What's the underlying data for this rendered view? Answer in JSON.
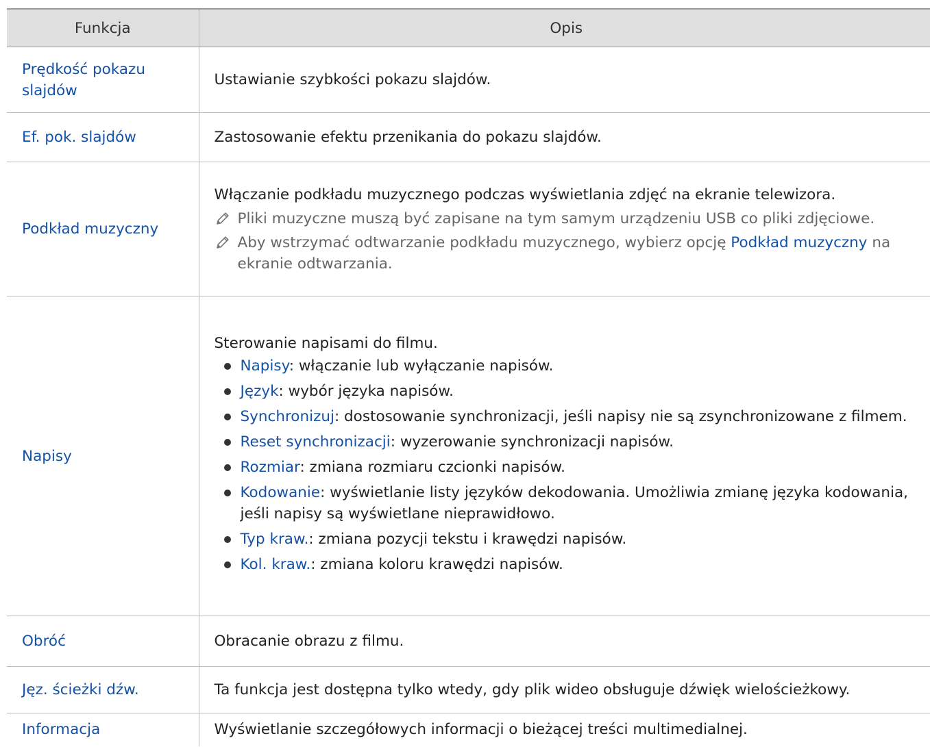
{
  "table": {
    "header": {
      "col1": "Funkcja",
      "col2": "Opis"
    },
    "rows": [
      {
        "name": "Prędkość pokazu slajdów",
        "desc": "Ustawianie szybkości pokazu slajdów."
      },
      {
        "name": "Ef. pok. slajdów",
        "desc": "Zastosowanie efektu przenikania do pokazu slajdów."
      },
      {
        "name": "Podkład muzyczny",
        "desc": "Włączanie podkładu muzycznego podczas wyświetlania zdjęć na ekranie telewizora.",
        "note1": "Pliki muzyczne muszą być zapisane na tym samym urządzeniu USB co pliki zdjęciowe.",
        "note2_pre": "Aby wstrzymać odtwarzanie podkładu muzycznego, wybierz opcję ",
        "note2_kw": "Podkład muzyczny",
        "note2_post": " na ekranie odtwarzania.",
        "note_icon": "pencil-icon"
      },
      {
        "name": "Napisy",
        "desc": "Sterowanie napisami do filmu.",
        "items": [
          {
            "kw": "Napisy",
            "text": ": włączanie lub wyłączanie napisów."
          },
          {
            "kw": "Język",
            "text": ": wybór języka napisów."
          },
          {
            "kw": "Synchronizuj",
            "text": ": dostosowanie synchronizacji, jeśli napisy nie są zsynchronizowane z filmem."
          },
          {
            "kw": "Reset synchronizacji",
            "text": ": wyzerowanie synchronizacji napisów."
          },
          {
            "kw": "Rozmiar",
            "text": ": zmiana rozmiaru czcionki napisów."
          },
          {
            "kw": "Kodowanie",
            "text": ": wyświetlanie listy języków dekodowania. Umożliwia zmianę języka kodowania, jeśli napisy są wyświetlane nieprawidłowo."
          },
          {
            "kw": "Typ kraw.",
            "text": ": zmiana pozycji tekstu i krawędzi napisów."
          },
          {
            "kw": "Kol. kraw.",
            "text": ": zmiana koloru krawędzi napisów."
          }
        ]
      },
      {
        "name": "Obróć",
        "desc": "Obracanie obrazu z filmu."
      },
      {
        "name": "Jęz. ścieżki dźw.",
        "desc": "Ta funkcja jest dostępna tylko wtedy, gdy plik wideo obsługuje dźwięk wielościeżkowy."
      },
      {
        "name": "Informacja",
        "desc": "Wyświetlanie szczegółowych informacji o bieżącej treści multimedialnej."
      }
    ]
  },
  "colors": {
    "keyword": "#1452a8",
    "header_bg": "#e0e0e0",
    "note_text": "#666666"
  }
}
